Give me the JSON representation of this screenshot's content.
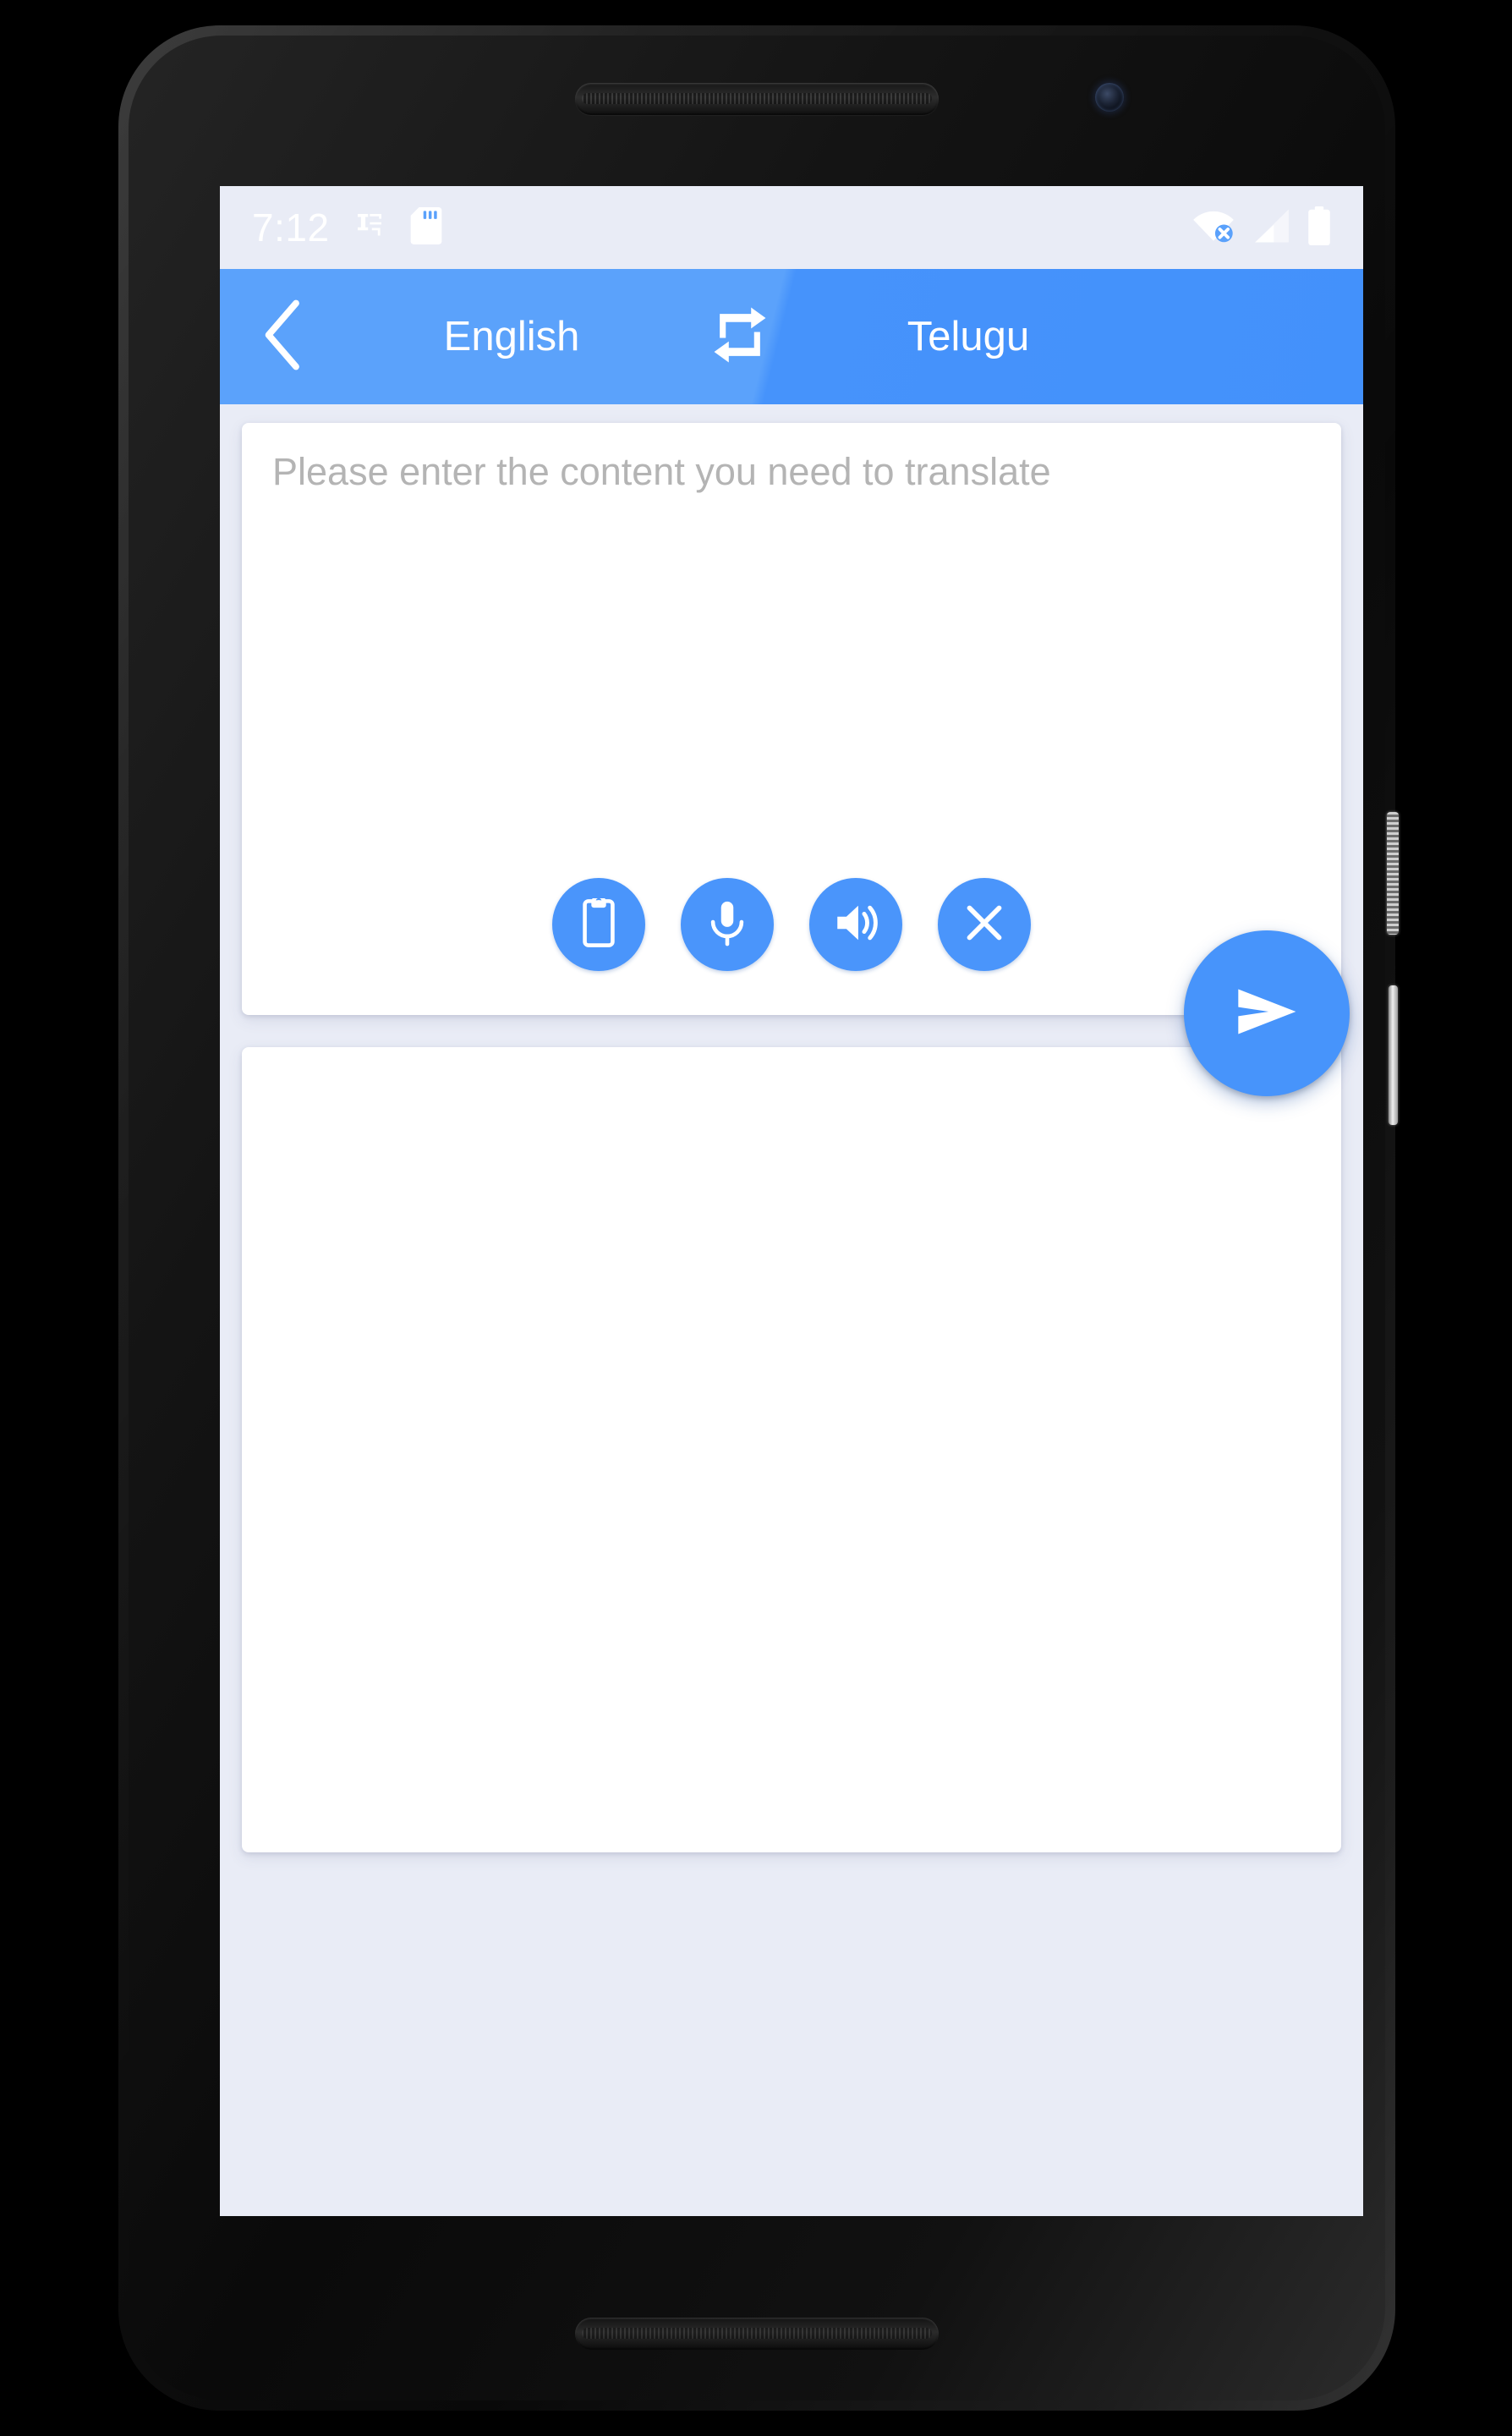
{
  "device": {
    "hardware": {
      "earpiece": "earpiece-speaker",
      "front_camera": "front-camera",
      "bottom_speaker": "bottom-speaker",
      "volume_rocker": "volume-rocker",
      "power_button": "power-button"
    }
  },
  "status_bar": {
    "clock": "7:12",
    "background_color": "#5AA1FB",
    "icons_left": [
      "input-method-icon",
      "sd-card-icon"
    ],
    "icons_right": [
      "wifi-disconnected-icon",
      "cellular-signal-icon",
      "battery-full-icon"
    ]
  },
  "app_bar": {
    "background_color": "#4C97FB",
    "back_label": "back-chevron",
    "source_language": "English",
    "swap_label": "swap-languages",
    "target_language": "Telugu"
  },
  "source_panel": {
    "placeholder": "Please enter the content you need to translate",
    "value": "",
    "tools": [
      {
        "name": "paste-button",
        "icon": "clipboard-icon"
      },
      {
        "name": "voice-input-button",
        "icon": "microphone-icon"
      },
      {
        "name": "speak-button",
        "icon": "speaker-icon"
      },
      {
        "name": "clear-button",
        "icon": "close-icon"
      }
    ],
    "button_color": "#4A95FB"
  },
  "target_panel": {
    "value": "",
    "placeholder": ""
  },
  "send_button": {
    "icon": "send-icon",
    "color": "#4794FB"
  },
  "nav_bar": {
    "background_color": "#4793FB",
    "buttons": [
      {
        "name": "nav-back-button",
        "icon": "triangle-back-icon"
      },
      {
        "name": "nav-home-button",
        "icon": "circle-home-icon"
      },
      {
        "name": "nav-recents-button",
        "icon": "square-recents-icon"
      }
    ]
  },
  "theme": {
    "page_background": "#E9ECF6",
    "card_background": "#FFFFFF",
    "accent": "#4793FB",
    "placeholder_text": "#B4B4B4"
  }
}
